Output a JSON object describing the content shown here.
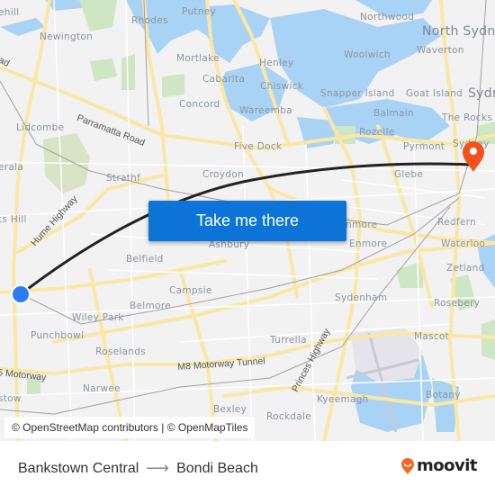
{
  "map": {
    "labels": [
      {
        "text": "ehill",
        "kind": "place"
      },
      {
        "text": "Rhodes",
        "kind": "place"
      },
      {
        "text": "Putney",
        "kind": "place"
      },
      {
        "text": "Newington",
        "kind": "place"
      },
      {
        "text": "Mortlake",
        "kind": "place"
      },
      {
        "text": "Cabarita",
        "kind": "place"
      },
      {
        "text": "Concord",
        "kind": "place"
      },
      {
        "text": "Lidcombe",
        "kind": "place"
      },
      {
        "text": "Northwood",
        "kind": "place"
      },
      {
        "text": "North Sydn",
        "kind": "city"
      },
      {
        "text": "Waverton",
        "kind": "place"
      },
      {
        "text": "Woolwich",
        "kind": "place"
      },
      {
        "text": "Henley",
        "kind": "place"
      },
      {
        "text": "Chiswick",
        "kind": "place"
      },
      {
        "text": "Snapper Island",
        "kind": "place"
      },
      {
        "text": "Goat Island",
        "kind": "place"
      },
      {
        "text": "Sydn",
        "kind": "city"
      },
      {
        "text": "Wareemba",
        "kind": "place"
      },
      {
        "text": "Balmain",
        "kind": "place"
      },
      {
        "text": "The Rocks",
        "kind": "place"
      },
      {
        "text": "Rozelle",
        "kind": "place"
      },
      {
        "text": "Five Dock",
        "kind": "place"
      },
      {
        "text": "Pyrmont",
        "kind": "place"
      },
      {
        "text": "Sydney",
        "kind": "place"
      },
      {
        "text": "erala",
        "kind": "place"
      },
      {
        "text": "Strathf",
        "kind": "place"
      },
      {
        "text": "Croydon",
        "kind": "place"
      },
      {
        "text": "Glebe",
        "kind": "place"
      },
      {
        "text": "ts Hill",
        "kind": "place"
      },
      {
        "text": "Redfern",
        "kind": "place"
      },
      {
        "text": "nmore",
        "kind": "place"
      },
      {
        "text": "Enmore",
        "kind": "place"
      },
      {
        "text": "Waterloo",
        "kind": "place"
      },
      {
        "text": "Ashbury",
        "kind": "place"
      },
      {
        "text": "Belfield",
        "kind": "place"
      },
      {
        "text": "Zetland",
        "kind": "place"
      },
      {
        "text": "Campsie",
        "kind": "place"
      },
      {
        "text": "Sydenham",
        "kind": "place"
      },
      {
        "text": "Rosebery",
        "kind": "place"
      },
      {
        "text": "Belmore",
        "kind": "place"
      },
      {
        "text": "Wiley Park",
        "kind": "place"
      },
      {
        "text": "Punchbowl",
        "kind": "place"
      },
      {
        "text": "Turrella",
        "kind": "place"
      },
      {
        "text": "Mascot",
        "kind": "place"
      },
      {
        "text": "Roselands",
        "kind": "place"
      },
      {
        "text": "Narwee",
        "kind": "place"
      },
      {
        "text": "Botany",
        "kind": "place"
      },
      {
        "text": "Kyeemagh",
        "kind": "place"
      },
      {
        "text": "Bexley",
        "kind": "place"
      },
      {
        "text": "Rockdale",
        "kind": "place"
      },
      {
        "text": "stow",
        "kind": "place"
      }
    ],
    "roads": [
      {
        "text": "Parramatta Road"
      },
      {
        "text": "Hume Highway"
      },
      {
        "text": "M8 Motorway Tunnel"
      },
      {
        "text": "Princes Highway"
      },
      {
        "text": "5 Motorway"
      },
      {
        "text": "oad"
      }
    ],
    "origin_marker": {
      "name": "Bankstown Central",
      "color": "#2b7bf3"
    },
    "destination_marker": {
      "name": "Bondi Beach",
      "color": "#f4511e"
    },
    "route_color": "#222222",
    "cta_label": "Take me there",
    "attribution": "© OpenStreetMap contributors | © OpenMapTiles"
  },
  "footer": {
    "origin": "Bankstown Central",
    "arrow": "⟶",
    "destination": "Bondi Beach",
    "brand": "moovit",
    "brand_color": "#f26722"
  }
}
